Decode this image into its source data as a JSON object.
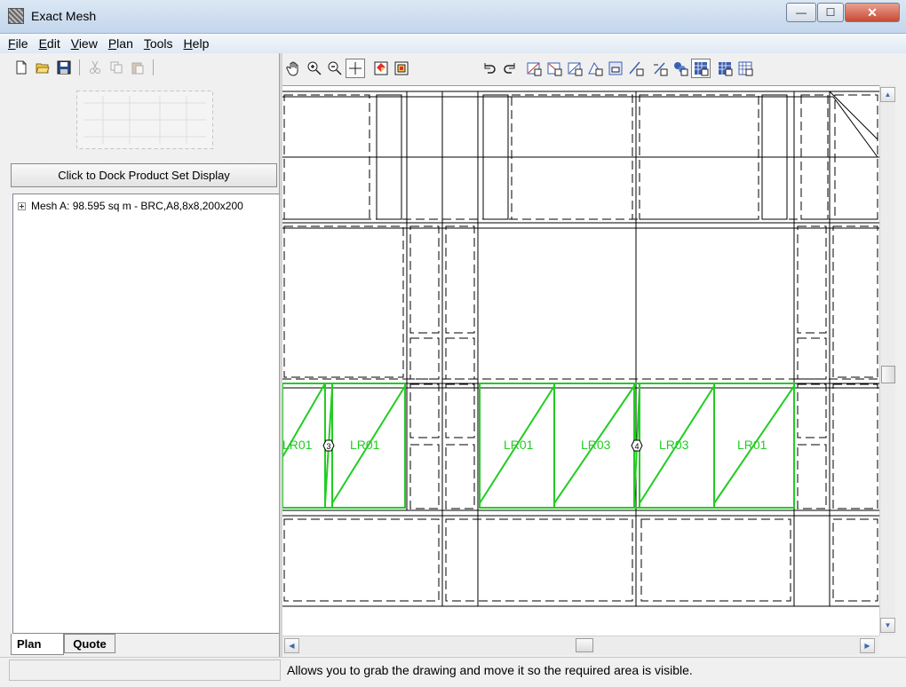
{
  "window": {
    "title": "Exact Mesh"
  },
  "window_controls": {
    "minimize": "—",
    "maximize": "☐",
    "close": "✕"
  },
  "menu": [
    {
      "label": "File",
      "accel": "F",
      "rest": "ile"
    },
    {
      "label": "Edit",
      "accel": "E",
      "rest": "dit"
    },
    {
      "label": "View",
      "accel": "V",
      "rest": "iew"
    },
    {
      "label": "Plan",
      "accel": "P",
      "rest": "lan"
    },
    {
      "label": "Tools",
      "accel": "T",
      "rest": "ools"
    },
    {
      "label": "Help",
      "accel": "H",
      "rest": "elp"
    }
  ],
  "left_panel": {
    "dock_button": "Click to Dock Product Set Display",
    "tree_items": [
      {
        "label": "Mesh A: 98.595 sq m - BRC,A8,8x8,200x200"
      }
    ],
    "tabs": [
      {
        "label": "Plan",
        "active": true
      },
      {
        "label": "Quote",
        "active": false
      }
    ]
  },
  "plan": {
    "mesh_labels": [
      "LR01",
      "LR01",
      "LR01",
      "LR03",
      "LR03",
      "LR01"
    ],
    "markers": [
      "3",
      "4"
    ],
    "mesh_color": "#22cc22"
  },
  "status": {
    "text": "Allows you to grab the drawing and move it so the required area is visible."
  }
}
